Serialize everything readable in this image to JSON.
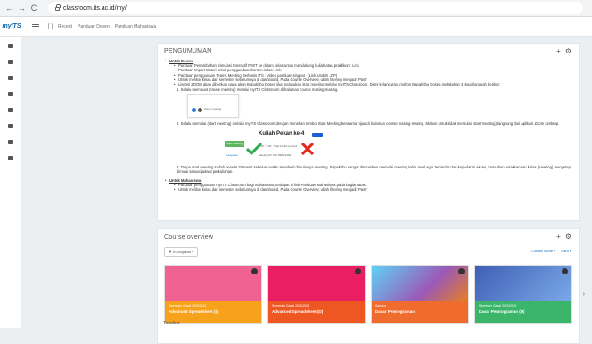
{
  "browser": {
    "url": "classroom.its.ac.id/my/",
    "back": "←",
    "forward": "→",
    "reload": "C"
  },
  "navbar": {
    "logo": "myITS",
    "sub_logo": "Classroom",
    "icons_text": "[ ]",
    "menu": [
      "Recent",
      "Panduan Dosen",
      "Panduan Mahasiswa"
    ]
  },
  "announcement": {
    "title": "PENGUMUMAN",
    "add_symbol": "+",
    "gear_symbol": "⚙",
    "dosen_heading": "Untuk Dosen!",
    "dosen_items": [
      "Panduan Penambahan Simulasi Interaktif PhET ke dalam kelas untuk mendukung kuliah atau praktikum: Link",
      "Panduan Import Materi untuk penggandaan konten kelas: Link",
      "Panduan penggunaan Teams Meeting Berbasis ITS : Video panduan singkat . (Link Unduh .ZIP)",
      "Untuk melihat kelas dan semester sebelumnya di dashboard, Pada Course Overview, ubah filtering menjadi \"Past\"",
      "Lisensi ZOOM akan diberikan pada akun Bapak/Ibu Dosen jika melakukan start meeting melalui myITS Classroom. Demi kelancaran, mohon Bapak/Ibu Dosen melakukan 3 (tiga) langkah berikut:"
    ],
    "step1": "1. Selalu membuat (create meeting) melalui myITS Classroom di halaman course masing-masing.",
    "step2": "2. Selalu memulai (start meeting) melalui myITS Classroom dengan menekan tombol Start Meeting berwarna hijau di halaman course masing-masing. Mohon untuk tidak memulai (start meeting) langsung dari aplikasi Zoom desktop.",
    "step3": "3. Tanpa start meeting sudah berada 20 menit sebelum waktu terjadwal dimulainya meeting. Bapak/Ibu sangat disarankan memulai meeting lebih awal agar terhindar dari kepadatan akses, kemudian pelaksanaan kelas (meeting) menyetap dimulai sesuai jadwal perkuliahan.",
    "shot1_label": "Zoom meeting",
    "shot2": {
      "green_btn": "Start Meeting",
      "link": "Lanjutkan",
      "class_title": "Kuliah Pekan ke-4",
      "time": "9:00 - 9:30 · Start for 30 minutes",
      "meeting_id": "Meeting ID: 910 9982 9402"
    },
    "mhs_heading": "Untuk Mahasiswa!",
    "mhs_items": [
      "Panduan penggunaan myITS Classroom bagi mahasiswa, terdapat di link Panduan Mahasiswa pada bagian atas.",
      "Untuk melihat kelas dan semester sebelumnya di dashboard, Pada Course Overview, ubah filtering menjadi \"Past\""
    ]
  },
  "course_overview": {
    "title": "Course overview",
    "filter_label": "In progress",
    "sort_label": "Course name",
    "view_label": "Card",
    "courses": [
      {
        "meta": "Semester Gasal 2020/2021",
        "name": "Advanced Spreadsheet (I)",
        "color": "#f7a21b",
        "img": "#f06292"
      },
      {
        "meta": "Semester Gasal 2020/2021",
        "name": "Advanced Spreadsheet (D)",
        "color": "#ee5722",
        "img": "#e91e63"
      },
      {
        "meta": "Sarjana",
        "name": "Dasar Pemrograman",
        "color": "#ef6c2e",
        "img": "#5dd2f7"
      },
      {
        "meta": "Semester Gasal 2020/2021",
        "name": "Dasar Pemrograman (D)",
        "color": "#3bb56a",
        "img": "#3f5fb5"
      }
    ]
  },
  "bottom_text": "Timeline"
}
